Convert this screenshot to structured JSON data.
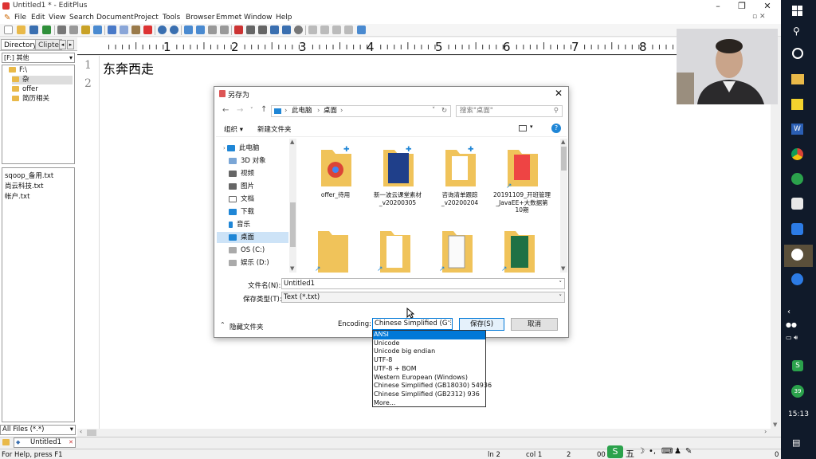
{
  "app": {
    "title": "Untitled1 * - EditPlus",
    "menu": [
      "File",
      "Edit",
      "View",
      "Search",
      "Document",
      "Project",
      "Tools",
      "Browser",
      "Emmet",
      "Window",
      "Help"
    ]
  },
  "left_panel": {
    "tabs": [
      "Directory",
      "Clipte"
    ],
    "drive": "[F:] 其他",
    "folders": [
      "F:\\",
      "杂",
      "offer",
      "简历相关"
    ],
    "files": [
      "sqoop_备用.txt",
      "尚云科技.txt",
      "帐户.txt"
    ],
    "filter": "All Files (*.*)"
  },
  "ruler": {
    "marks": [
      "1",
      "2",
      "3",
      "4",
      "5",
      "6",
      "7",
      "8"
    ]
  },
  "editor": {
    "line_numbers": [
      "1",
      "2"
    ],
    "line1": "东奔西走"
  },
  "doc_tab": "Untitled1",
  "status": {
    "help": "For Help, press F1",
    "ln": "ln 2",
    "col": "col 1",
    "num": "2",
    "extra": "00",
    "right": "0"
  },
  "dialog": {
    "title": "另存为",
    "path": [
      "此电脑",
      "桌面"
    ],
    "search_placeholder": "搜索\"桌面\"",
    "organize": "组织 ▾",
    "new_folder": "新建文件夹",
    "nav_items": [
      "此电脑",
      "3D 对象",
      "视频",
      "图片",
      "文档",
      "下载",
      "音乐",
      "桌面",
      "OS (C:)",
      "娱乐 (D:)"
    ],
    "files": [
      {
        "name": "offer_待用"
      },
      {
        "name": "新一波云课堂素材_v20200305"
      },
      {
        "name": "咨询清单跟踪_v20200204"
      },
      {
        "name": "20191109_开班管理_JavaEE+大数据第10期"
      }
    ],
    "filename_label": "文件名(N):",
    "filename": "Untitled1",
    "filetype_label": "保存类型(T):",
    "filetype": "Text (*.txt)",
    "hide_folders": "隐藏文件夹",
    "encoding_label": "Encoding:",
    "encoding_selected": "Chinese Simplified (GE",
    "encoding_options": [
      "ANSI",
      "Unicode",
      "Unicode big endian",
      "UTF-8",
      "UTF-8 + BOM",
      "Western European (Windows)",
      "Chinese Simplified (GB18030) 54936",
      "Chinese Simplified (GB2312) 936",
      "More..."
    ],
    "save": "保存(S)",
    "cancel": "取消"
  },
  "taskbar": {
    "time": "15:13",
    "badge": "39"
  },
  "colors": {
    "accent": "#0078d7",
    "taskbar": "#101a2a",
    "folder": "#e9b949"
  }
}
